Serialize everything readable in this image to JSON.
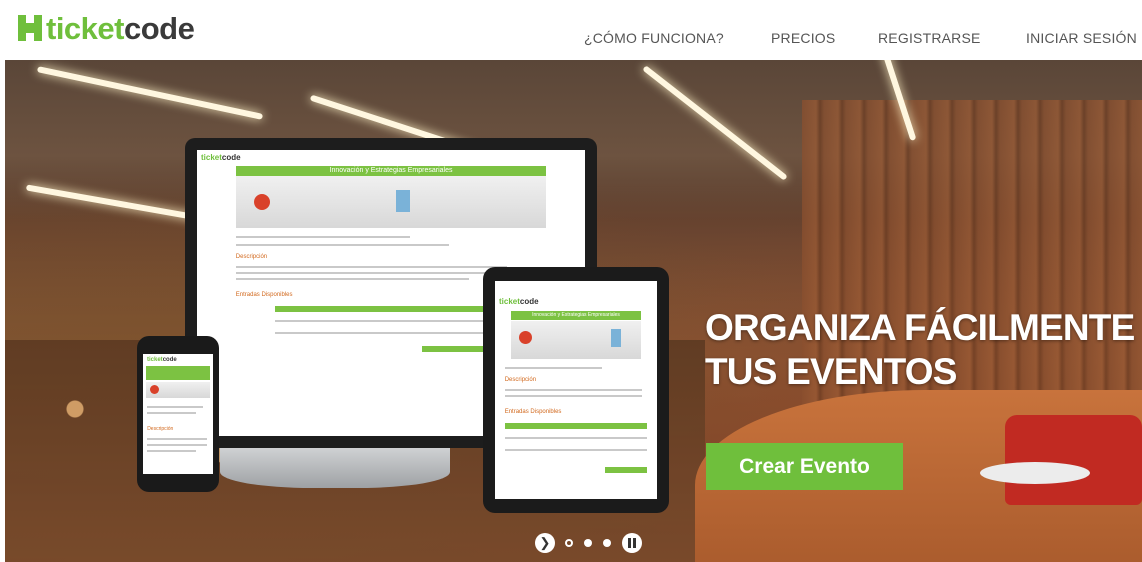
{
  "brand": {
    "logo_part1": "ticket",
    "logo_part2": "code",
    "accent_color": "#6fbf3c"
  },
  "nav": {
    "items": [
      {
        "label": "¿CÓMO FUNCIONA?"
      },
      {
        "label": "PRECIOS"
      },
      {
        "label": "REGISTRARSE"
      },
      {
        "label": "INICIAR SESIÓN"
      }
    ]
  },
  "hero": {
    "headline_line1": "ORGANIZA FÁCILMENTE",
    "headline_line2": "TUS EVENTOS",
    "cta_label": "Crear Evento",
    "device_mockup": {
      "logo_part1": "ticket",
      "logo_part2": "code",
      "event_title": "Innovación y Estrategias Empresariales",
      "section_description": "Descripción",
      "section_tickets": "Entradas Disponibles"
    }
  },
  "carousel": {
    "next_icon": "chevron-right-icon",
    "slide_count": 3,
    "active_slide": 1,
    "pause_icon": "pause-icon"
  }
}
